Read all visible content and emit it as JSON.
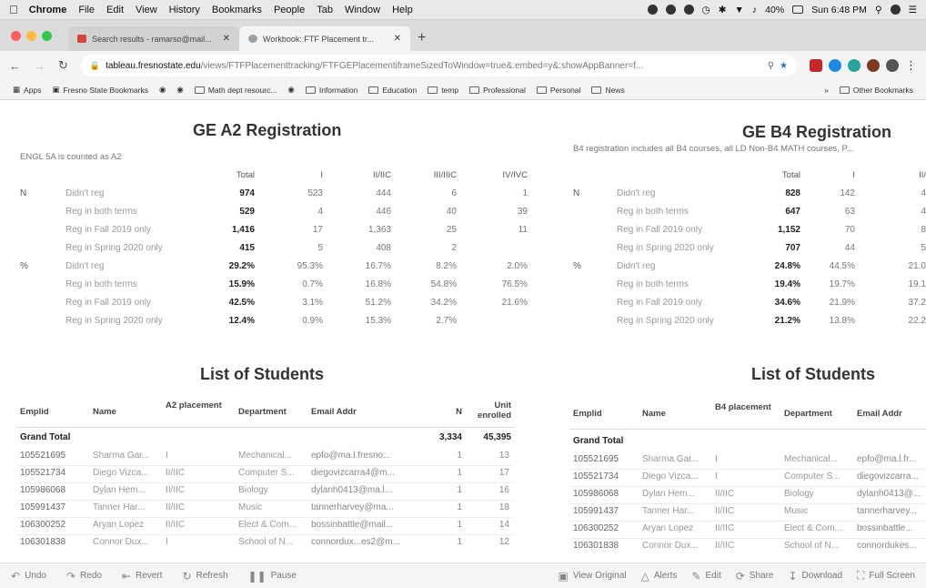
{
  "menubar": {
    "app": "Chrome",
    "items": [
      "File",
      "Edit",
      "View",
      "History",
      "Bookmarks",
      "People",
      "Tab",
      "Window",
      "Help"
    ],
    "battery": "40%",
    "time": "Sun 6:48 PM"
  },
  "tabs": [
    {
      "label": "Search results - ramarso@mail...",
      "active": false,
      "favicon_color": "#d44638"
    },
    {
      "label": "Workbook: FTF Placement tr...",
      "active": true,
      "favicon_color": "#9aa0a6"
    }
  ],
  "address": {
    "host": "tableau.fresnostate.edu",
    "path": "/views/FTFPlacementtracking/FTFGEPlacementiframeSizedToWindow=true&:embed=y&:showAppBanner=f..."
  },
  "bookmarks": {
    "items": [
      "Apps",
      "Fresno State Bookmarks",
      "Math dept resourc...",
      "Information",
      "Education",
      "temp",
      "Professional",
      "Personal",
      "News"
    ],
    "other": "Other Bookmarks"
  },
  "left": {
    "title": "GE A2 Registration",
    "note": "ENGL 5A is counted as A2",
    "columns": [
      "Total",
      "I",
      "II/IIC",
      "III/IIIC",
      "IV/IVC"
    ],
    "groups": [
      {
        "label": "N",
        "rows": [
          {
            "label": "Didn't reg",
            "values": [
              "974",
              "523",
              "444",
              "6",
              "1"
            ]
          },
          {
            "label": "Reg in both terms",
            "values": [
              "529",
              "4",
              "446",
              "40",
              "39"
            ]
          },
          {
            "label": "Reg in Fall 2019 only",
            "values": [
              "1,416",
              "17",
              "1,363",
              "25",
              "11"
            ]
          },
          {
            "label": "Reg in Spring 2020 only",
            "values": [
              "415",
              "5",
              "408",
              "2",
              ""
            ]
          }
        ]
      },
      {
        "label": "%",
        "rows": [
          {
            "label": "Didn't reg",
            "values": [
              "29.2%",
              "95.3%",
              "16.7%",
              "8.2%",
              "2.0%"
            ]
          },
          {
            "label": "Reg in both terms",
            "values": [
              "15.9%",
              "0.7%",
              "16.8%",
              "54.8%",
              "76.5%"
            ]
          },
          {
            "label": "Reg in Fall 2019 only",
            "values": [
              "42.5%",
              "3.1%",
              "51.2%",
              "34.2%",
              "21.6%"
            ]
          },
          {
            "label": "Reg in Spring 2020 only",
            "values": [
              "12.4%",
              "0.9%",
              "15.3%",
              "2.7%",
              ""
            ]
          }
        ]
      }
    ],
    "list_title": "List of Students",
    "list_columns": [
      "Emplid",
      "Name",
      "A2 placement",
      "Department",
      "Email Addr",
      "N",
      "Unit enrolled"
    ],
    "grand_total": {
      "label": "Grand Total",
      "n": "3,334",
      "units": "45,395"
    },
    "students": [
      {
        "id": "105521695",
        "name": "Sharma Gar...",
        "placement": "I",
        "dept": "Mechanical...",
        "email": "epfo@ma.l.fresno...",
        "n": "1",
        "units": "13"
      },
      {
        "id": "105521734",
        "name": "Diego Vizca...",
        "placement": "II/IIC",
        "dept": "Computer S...",
        "email": "diegovizcarra4@m...",
        "n": "1",
        "units": "17"
      },
      {
        "id": "105986068",
        "name": "Dylan Hem...",
        "placement": "II/IIC",
        "dept": "Biology",
        "email": "dylanh0413@ma.l...",
        "n": "1",
        "units": "16"
      },
      {
        "id": "105991437",
        "name": "Tanner Har...",
        "placement": "II/IIC",
        "dept": "Music",
        "email": "tannerharvey@ma...",
        "n": "1",
        "units": "18"
      },
      {
        "id": "106300252",
        "name": "Aryan Lopez",
        "placement": "II/IIC",
        "dept": "Elect & Com...",
        "email": "bossinbattle@mail...",
        "n": "1",
        "units": "14"
      },
      {
        "id": "106301838",
        "name": "Connor Dux...",
        "placement": "I",
        "dept": "School of N...",
        "email": "connordux...es2@m...",
        "n": "1",
        "units": "12"
      }
    ]
  },
  "right": {
    "title": "GE B4 Registration",
    "note": "B4 registration includes all B4 courses, all LD Non-B4 MATH courses, P...",
    "columns": [
      "Total",
      "I",
      "II/"
    ],
    "groups": [
      {
        "label": "N",
        "rows": [
          {
            "label": "Didn't reg",
            "values": [
              "828",
              "142",
              "4"
            ]
          },
          {
            "label": "Reg in both terms",
            "values": [
              "647",
              "63",
              "4"
            ]
          },
          {
            "label": "Reg in Fall 2019 only",
            "values": [
              "1,152",
              "70",
              "8"
            ]
          },
          {
            "label": "Reg in Spring 2020 only",
            "values": [
              "707",
              "44",
              "5"
            ]
          }
        ]
      },
      {
        "label": "%",
        "rows": [
          {
            "label": "Didn't reg",
            "values": [
              "24.8%",
              "44.5%",
              "21.0"
            ]
          },
          {
            "label": "Reg in both terms",
            "values": [
              "19.4%",
              "19.7%",
              "19.1"
            ]
          },
          {
            "label": "Reg in Fall 2019 only",
            "values": [
              "34.6%",
              "21.9%",
              "37.2"
            ]
          },
          {
            "label": "Reg in Spring 2020 only",
            "values": [
              "21.2%",
              "13.8%",
              "22.2"
            ]
          }
        ]
      }
    ],
    "list_title": "List of Students",
    "list_columns": [
      "Emplid",
      "Name",
      "B4 placement",
      "Department",
      "Email Addr"
    ],
    "grand_total": {
      "label": "Grand Total"
    },
    "students": [
      {
        "id": "105521695",
        "name": "Sharma Gar...",
        "placement": "I",
        "dept": "Mechanical...",
        "email": "epfo@ma.l.fr..."
      },
      {
        "id": "105521734",
        "name": "Diego Vizca...",
        "placement": "I",
        "dept": "Computer S...",
        "email": "diegovizcarra..."
      },
      {
        "id": "105986068",
        "name": "Dylan Hem...",
        "placement": "II/IIC",
        "dept": "Biology",
        "email": "dylanh0413@..."
      },
      {
        "id": "105991437",
        "name": "Tanner Har...",
        "placement": "II/IIC",
        "dept": "Music",
        "email": "tannerharvey..."
      },
      {
        "id": "106300252",
        "name": "Aryan Lopez",
        "placement": "II/IIC",
        "dept": "Elect & Com...",
        "email": "bossinbattle..."
      },
      {
        "id": "106301838",
        "name": "Connor Dux...",
        "placement": "II/IIC",
        "dept": "School of N...",
        "email": "connordukes..."
      }
    ]
  },
  "toolbar": {
    "left": [
      {
        "label": "Undo",
        "icon": "undo-icon"
      },
      {
        "label": "Redo",
        "icon": "redo-icon"
      },
      {
        "label": "Revert",
        "icon": "revert-icon"
      },
      {
        "label": "Refresh",
        "icon": "refresh-icon"
      },
      {
        "label": "Pause",
        "icon": "pause-icon"
      }
    ],
    "right": [
      {
        "label": "View Original",
        "icon": "view-original-icon"
      },
      {
        "label": "Alerts",
        "icon": "alert-icon"
      },
      {
        "label": "Edit",
        "icon": "edit-icon"
      },
      {
        "label": "Share",
        "icon": "share-icon"
      },
      {
        "label": "Download",
        "icon": "download-icon"
      },
      {
        "label": "Full Screen",
        "icon": "fullscreen-icon"
      }
    ]
  }
}
